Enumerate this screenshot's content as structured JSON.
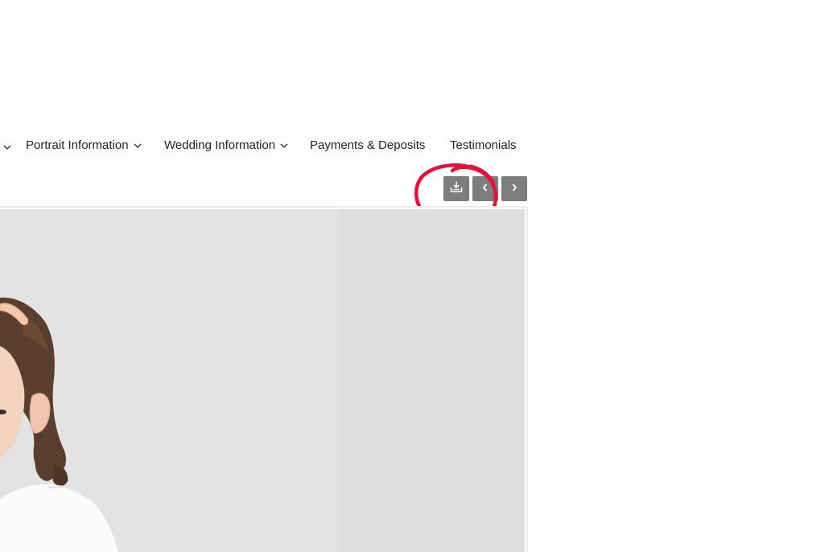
{
  "nav": {
    "items": [
      {
        "label": "Portrait Information",
        "has_dropdown": true
      },
      {
        "label": "Wedding Information",
        "has_dropdown": true
      },
      {
        "label": "Payments & Deposits",
        "has_dropdown": false
      },
      {
        "label": "Testimonials",
        "has_dropdown": false
      }
    ]
  },
  "gallery_controls": {
    "download_icon": "download-tray-icon",
    "prev_icon": "chevron-left-icon",
    "next_icon": "chevron-right-icon",
    "button_color": "#7d7d7d"
  },
  "annotation": {
    "color": "#e8103a",
    "shape": "hand-drawn circle around download button"
  },
  "photo": {
    "subject": "young girl with curly pigtails and white shirt on light grey backdrop"
  }
}
